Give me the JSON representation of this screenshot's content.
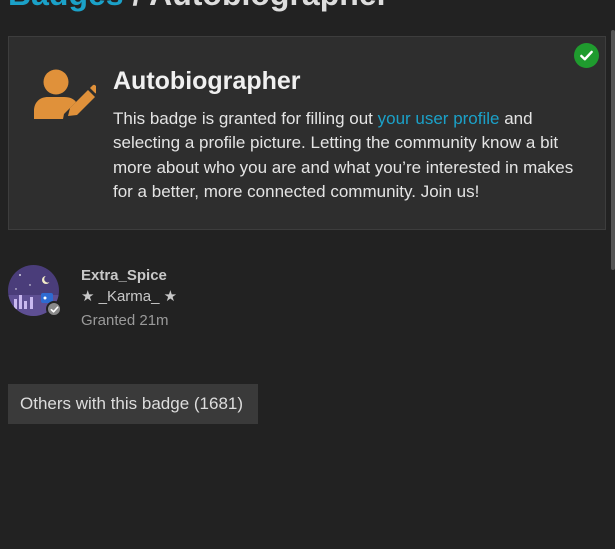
{
  "breadcrumb": {
    "parent_label": "Badges",
    "separator": "/",
    "current_label": "Autobiographer"
  },
  "badge": {
    "title": "Autobiographer",
    "description_before": "This badge is granted for filling out ",
    "description_link": "your user profile",
    "description_after": " and selecting a profile picture. Letting the community know a bit more about who you are and what you’re interested in makes for a better, more connected community. Join us!",
    "icon": "user-edit-icon",
    "icon_color": "#e0913a",
    "granted_icon": "check-circle-icon",
    "granted_color": "#1f9b2e"
  },
  "grant": {
    "username": "Extra_Spice",
    "user_title": "★ _Karma_ ★",
    "granted_text": "Granted 21m"
  },
  "others_button": {
    "label": "Others with this badge (1681)"
  },
  "colors": {
    "background": "#222222",
    "card": "#2e2e2e",
    "link": "#1ba1c8"
  }
}
